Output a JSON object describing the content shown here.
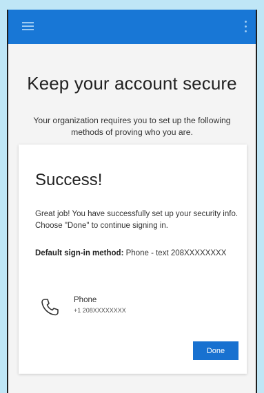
{
  "header": {
    "menu_icon": "hamburger-menu-icon",
    "more_icon": "more-vertical-icon"
  },
  "page": {
    "title": "Keep your account secure",
    "subtitle": "Your organization requires you to set up the following methods of proving who you are."
  },
  "card": {
    "title": "Success!",
    "message": "Great job! You have successfully set up your security info. Choose \"Done\" to continue signing in.",
    "default_method_label": "Default sign-in method:",
    "default_method_value": "Phone - text 208XXXXXXXX",
    "method": {
      "icon": "phone-icon",
      "name": "Phone",
      "number": "+1 208XXXXXXXX"
    },
    "done_label": "Done"
  },
  "colors": {
    "background": "#bfe6f6",
    "topbar": "#1877d6",
    "button": "#1871d0",
    "card": "#ffffff"
  }
}
